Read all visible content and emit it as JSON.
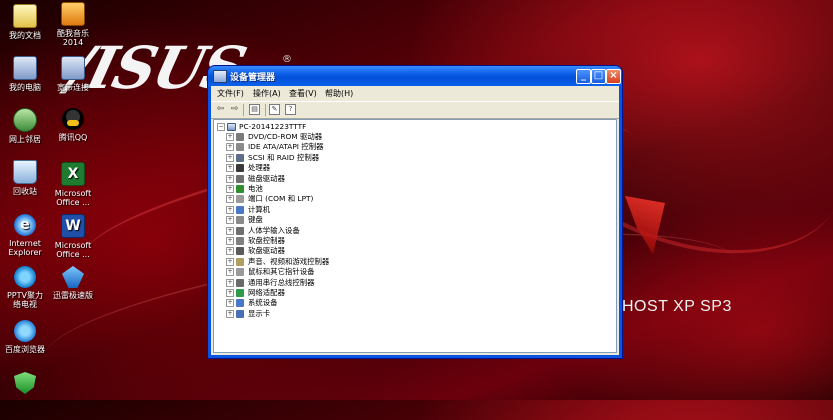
{
  "desktop": {
    "watermark_text": "HOST XP SP3",
    "logo_text": "/ISUS",
    "icons": [
      {
        "label": "我的文档",
        "icon": "documents-icon"
      },
      {
        "label": "酷我音乐\n2014",
        "icon": "music-icon"
      },
      {
        "label": "我的电脑",
        "icon": "computer-icon"
      },
      {
        "label": "宽带连接",
        "icon": "broadband-icon"
      },
      {
        "label": "网上邻居",
        "icon": "network-icon"
      },
      {
        "label": "腾讯QQ",
        "icon": "qq-icon"
      },
      {
        "label": "回收站",
        "icon": "recycle-bin-icon"
      },
      {
        "label": "Microsoft\nOffice ...",
        "icon": "excel-icon"
      },
      {
        "label": "Internet\nExplorer",
        "icon": "ie-icon"
      },
      {
        "label": "Microsoft\nOffice ...",
        "icon": "word-icon"
      },
      {
        "label": "PPTV聚力\n络电视",
        "icon": "pptv-icon"
      },
      {
        "label": "迅雷极速版",
        "icon": "xunlei-icon"
      },
      {
        "label": "百度浏览器",
        "icon": "baidu-browser-icon"
      },
      {
        "label": "",
        "icon": "security-shield-icon"
      }
    ]
  },
  "window": {
    "title": "设备管理器",
    "controls": {
      "minimize": "_",
      "maximize": "□",
      "close": "×"
    },
    "menu": [
      "文件(F)",
      "操作(A)",
      "查看(V)",
      "帮助(H)"
    ],
    "toolbar": [
      "back-arrow-icon",
      "forward-arrow-icon",
      "show-hide-console-tree-icon",
      "properties-icon",
      "help-icon"
    ],
    "tree": {
      "root": "PC-20141223TTTF",
      "root_expander": "−",
      "child_expander": "+",
      "children": [
        {
          "label": "DVD/CD-ROM 驱动器",
          "icon": "dvd-drive-icon",
          "color": "#7a7a7a"
        },
        {
          "label": "IDE ATA/ATAPI 控制器",
          "icon": "ide-controller-icon",
          "color": "#8a8a8a"
        },
        {
          "label": "SCSI 和 RAID 控制器",
          "icon": "scsi-controller-icon",
          "color": "#5e6e8a"
        },
        {
          "label": "处理器",
          "icon": "processor-icon",
          "color": "#3a3a3a"
        },
        {
          "label": "磁盘驱动器",
          "icon": "disk-drive-icon",
          "color": "#6f6f6f"
        },
        {
          "label": "电池",
          "icon": "battery-icon",
          "color": "#2f8f2f"
        },
        {
          "label": "端口 (COM 和 LPT)",
          "icon": "port-icon",
          "color": "#9a9a9a"
        },
        {
          "label": "计算机",
          "icon": "computer-icon",
          "color": "#4a78c8"
        },
        {
          "label": "键盘",
          "icon": "keyboard-icon",
          "color": "#8a8a8a"
        },
        {
          "label": "人体学输入设备",
          "icon": "hid-icon",
          "color": "#6f6f6f"
        },
        {
          "label": "软盘控制器",
          "icon": "floppy-controller-icon",
          "color": "#7f7f7f"
        },
        {
          "label": "软盘驱动器",
          "icon": "floppy-drive-icon",
          "color": "#5a5a5a"
        },
        {
          "label": "声音、视频和游戏控制器",
          "icon": "sound-icon",
          "color": "#b0a060"
        },
        {
          "label": "鼠标和其它指针设备",
          "icon": "mouse-icon",
          "color": "#9a9a9a"
        },
        {
          "label": "通用串行总线控制器",
          "icon": "usb-icon",
          "color": "#6a6a6a"
        },
        {
          "label": "网络适配器",
          "icon": "network-adapter-icon",
          "color": "#2f9a4a"
        },
        {
          "label": "系统设备",
          "icon": "system-device-icon",
          "color": "#4a78c8"
        },
        {
          "label": "显示卡",
          "icon": "display-adapter-icon",
          "color": "#4a6fb8"
        }
      ]
    }
  }
}
